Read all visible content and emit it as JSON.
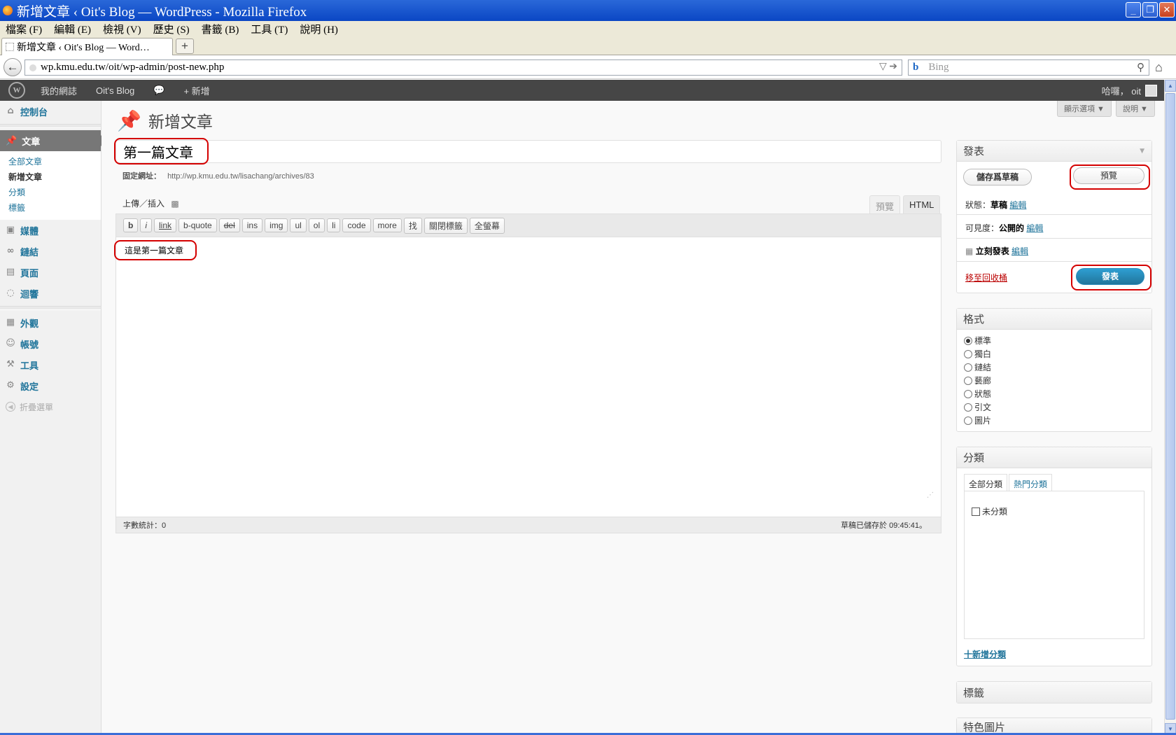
{
  "window": {
    "title": "新增文章 ‹ Oit's Blog — WordPress - Mozilla Firefox"
  },
  "menubar": [
    "檔案 (F)",
    "編輯 (E)",
    "檢視 (V)",
    "歷史 (S)",
    "書籤 (B)",
    "工具 (T)",
    "說明 (H)"
  ],
  "tab": {
    "title": "新增文章 ‹ Oit's Blog — Word…",
    "new_tab": "+"
  },
  "navbar": {
    "url": "wp.kmu.edu.tw/oit/wp-admin/post-new.php",
    "search_engine": "b",
    "search_placeholder": "Bing"
  },
  "adminbar": {
    "logo": "W",
    "items": [
      "我的網誌",
      "Oit's Blog",
      "💬",
      "+ 新增"
    ],
    "greeting": "哈囉， oit"
  },
  "sidebar": {
    "dashboard": "控制台",
    "posts": "文章",
    "posts_sub": [
      "全部文章",
      "新增文章",
      "分類",
      "標籤"
    ],
    "media": "媒體",
    "links": "鏈結",
    "pages": "頁面",
    "comments": "迴響",
    "appearance": "外觀",
    "users": "帳號",
    "tools": "工具",
    "settings": "設定",
    "collapse": "折疊選單"
  },
  "screen_options": [
    "顯示選項 ▼",
    "說明 ▼"
  ],
  "page": {
    "title": "新增文章",
    "post_title": "第一篇文章",
    "permalink_label": "固定網址：",
    "permalink_url": "http://wp.kmu.edu.tw/lisachang/archives/83",
    "upload_label": "上傳／插入"
  },
  "editor": {
    "tabs": [
      "預覽",
      "HTML"
    ],
    "quicktags": [
      "b",
      "i",
      "link",
      "b-quote",
      "del",
      "ins",
      "img",
      "ul",
      "ol",
      "li",
      "code",
      "more",
      "找",
      "關閉標籤",
      "全螢幕"
    ],
    "content": "這是第一篇文章",
    "word_count": "字數統計：0",
    "draft_saved": "草稿已儲存於 09:45:41。"
  },
  "publish_box": {
    "title": "發表",
    "save_draft": "儲存爲草稿",
    "preview": "預覽",
    "status_label": "狀態：",
    "status_value": "草稿",
    "edit": "編輯",
    "visibility_label": "可見度：",
    "visibility_value": "公開的",
    "schedule_value": "立刻發表",
    "trash": "移至回收桶",
    "publish": "發表"
  },
  "format_box": {
    "title": "格式",
    "options": [
      "標準",
      "獨白",
      "鏈結",
      "藝廊",
      "狀態",
      "引文",
      "圖片"
    ],
    "selected": "標準"
  },
  "category_box": {
    "title": "分類",
    "tabs": [
      "全部分類",
      "熱門分類"
    ],
    "items": [
      "未分類"
    ],
    "add_new": "十新增分類"
  },
  "tags_box": {
    "title": "標籤"
  },
  "featured_box": {
    "title": "特色圖片"
  }
}
